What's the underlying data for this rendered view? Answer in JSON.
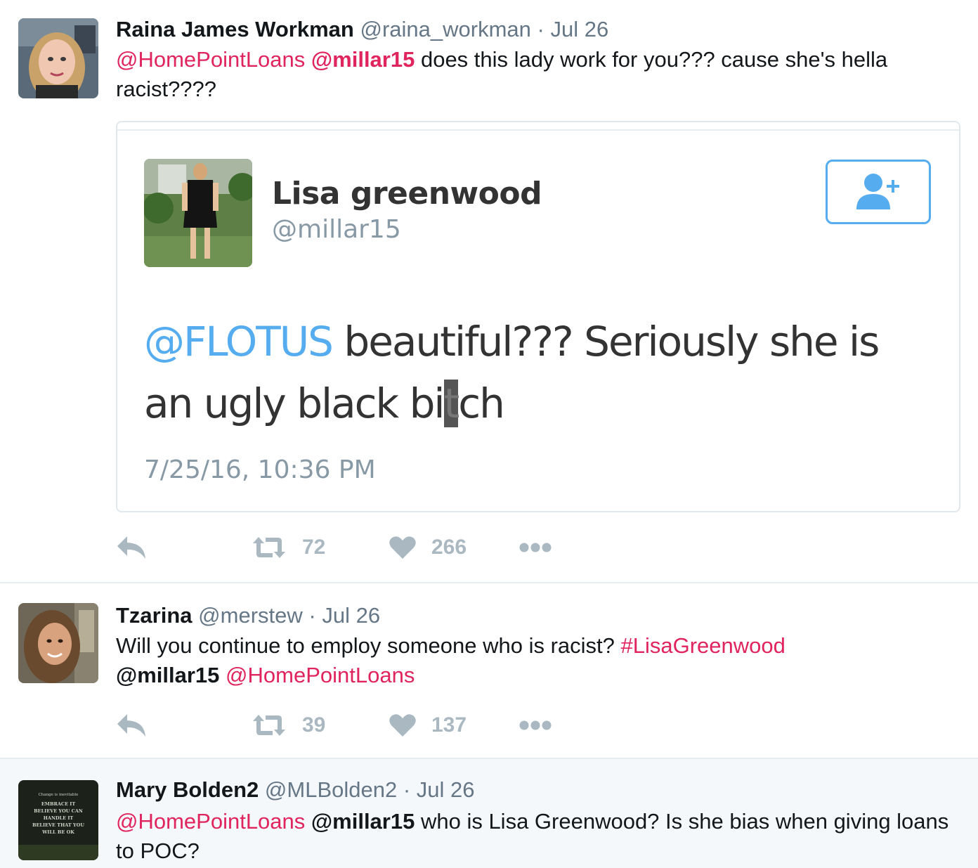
{
  "tweets": [
    {
      "name": "Raina James Workman",
      "handle": "@raina_workman",
      "separator": "·",
      "date": "Jul 26",
      "text": {
        "mention1": "@HomePointLoans",
        "mention2": "@millar15",
        "body": " does this lady work for you??? cause she's hella racist????"
      },
      "quoted_card": {
        "name": "Lisa greenwood",
        "handle": "@millar15",
        "mention": "@FLOTUS",
        "body_line1": " beautiful??? Seriously she is",
        "body_line2": "an ugly black bi",
        "body_censored": "t",
        "body_end": "ch",
        "timestamp": "7/25/16, 10:36 PM"
      },
      "actions": {
        "retweets": "72",
        "likes": "266"
      }
    },
    {
      "name": "Tzarina",
      "handle": "@merstew",
      "separator": "·",
      "date": "Jul 26",
      "text": {
        "body": "Will you continue to employ someone who is racist? ",
        "hashtag": "#LisaGreenwood",
        "mention_bold": "@millar15",
        "mention_red": "@HomePointLoans"
      },
      "actions": {
        "retweets": "39",
        "likes": "137"
      }
    },
    {
      "name": "Mary Bolden2",
      "handle": "@MLBolden2",
      "separator": "·",
      "date": "Jul 26",
      "text": {
        "mention_red": "@HomePointLoans",
        "mention_bold": "@millar15",
        "body": " who is Lisa Greenwood?  Is she bias when giving loans to POC?"
      },
      "avatar_text": [
        "Change is inevitable",
        "EMBRACE IT",
        "BELIEVE YOU CAN",
        "HANDLE IT",
        "BELIEVE THAT YOU",
        "WILL BE OK"
      ]
    }
  ],
  "icons": {
    "reply": "reply-icon",
    "retweet": "retweet-icon",
    "like": "heart-icon",
    "more": "more-icon",
    "follow": "follow-user-icon"
  },
  "colors": {
    "mention_red": "#e0245e",
    "card_mention_blue": "#55acee",
    "muted_gray": "#657786",
    "action_gray": "#aab8c2"
  }
}
